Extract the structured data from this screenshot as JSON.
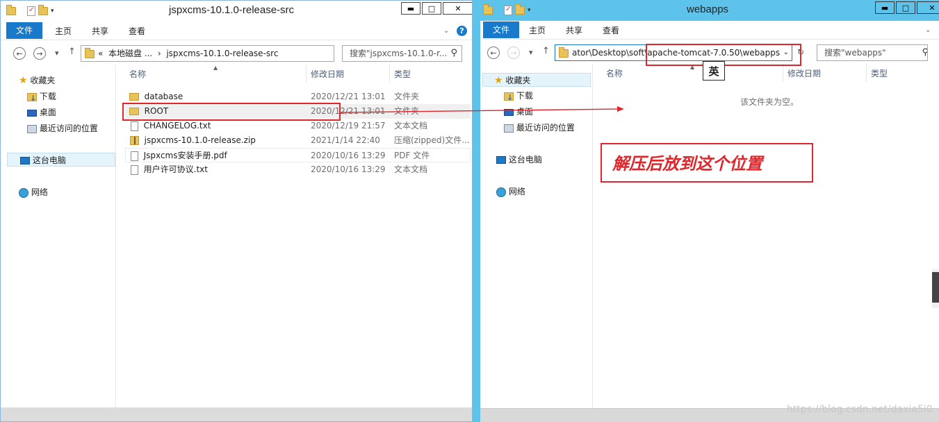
{
  "left": {
    "title": "jspxcms-10.1.0-release-src",
    "ribbon": {
      "file": "文件",
      "home": "主页",
      "share": "共享",
      "view": "查看"
    },
    "address": {
      "prefix": "«",
      "crumb1": "本地磁盘 ...",
      "sep": "›",
      "crumb2": "jspxcms-10.1.0-release-src"
    },
    "search_placeholder": "搜索\"jspxcms-10.1.0-r...",
    "nav": {
      "favorites": "收藏夹",
      "downloads": "下载",
      "desktop": "桌面",
      "recent": "最近访问的位置",
      "this_pc": "这台电脑",
      "network": "网络"
    },
    "columns": {
      "name": "名称",
      "date": "修改日期",
      "type": "类型"
    },
    "files": [
      {
        "name": "database",
        "date": "2020/12/21 13:01",
        "type": "文件夹",
        "icon": "folder-icon"
      },
      {
        "name": "ROOT",
        "date": "2020/12/21 13:01",
        "type": "文件夹",
        "icon": "folder-icon"
      },
      {
        "name": "CHANGELOG.txt",
        "date": "2020/12/19 21:57",
        "type": "文本文档",
        "icon": "text-file-icon"
      },
      {
        "name": "jspxcms-10.1.0-release.zip",
        "date": "2021/1/14 22:40",
        "type": "压缩(zipped)文件...",
        "icon": "zip-file-icon"
      },
      {
        "name": "Jspxcms安装手册.pdf",
        "date": "2020/10/16 13:29",
        "type": "PDF 文件",
        "icon": "pdf-file-icon"
      },
      {
        "name": "用户许可协议.txt",
        "date": "2020/10/16 13:29",
        "type": "文本文档",
        "icon": "text-file-icon"
      }
    ]
  },
  "right": {
    "title": "webapps",
    "ribbon": {
      "file": "文件",
      "home": "主页",
      "share": "共享",
      "view": "查看"
    },
    "address": {
      "path": "ator\\Desktop\\soft\\apache-tomcat-7.0.50\\webapps"
    },
    "search_placeholder": "搜索\"webapps\"",
    "nav": {
      "favorites": "收藏夹",
      "downloads": "下载",
      "desktop": "桌面",
      "recent": "最近访问的位置",
      "this_pc": "这台电脑",
      "network": "网络"
    },
    "columns": {
      "name": "名称",
      "date": "修改日期",
      "type": "类型"
    },
    "empty_message": "该文件夹为空。"
  },
  "annotation": {
    "text": "解压后放到这个位置",
    "color": "#e0252b"
  },
  "ime_indicator": "英",
  "watermark": "https://blog.csdn.net/daxia5i0",
  "window_buttons": {
    "minimize": "▬",
    "maximize": "□",
    "close": "✕"
  },
  "colors": {
    "accent": "#1979ca",
    "active_title": "#5ec3ea",
    "annotation": "#e0252b"
  }
}
